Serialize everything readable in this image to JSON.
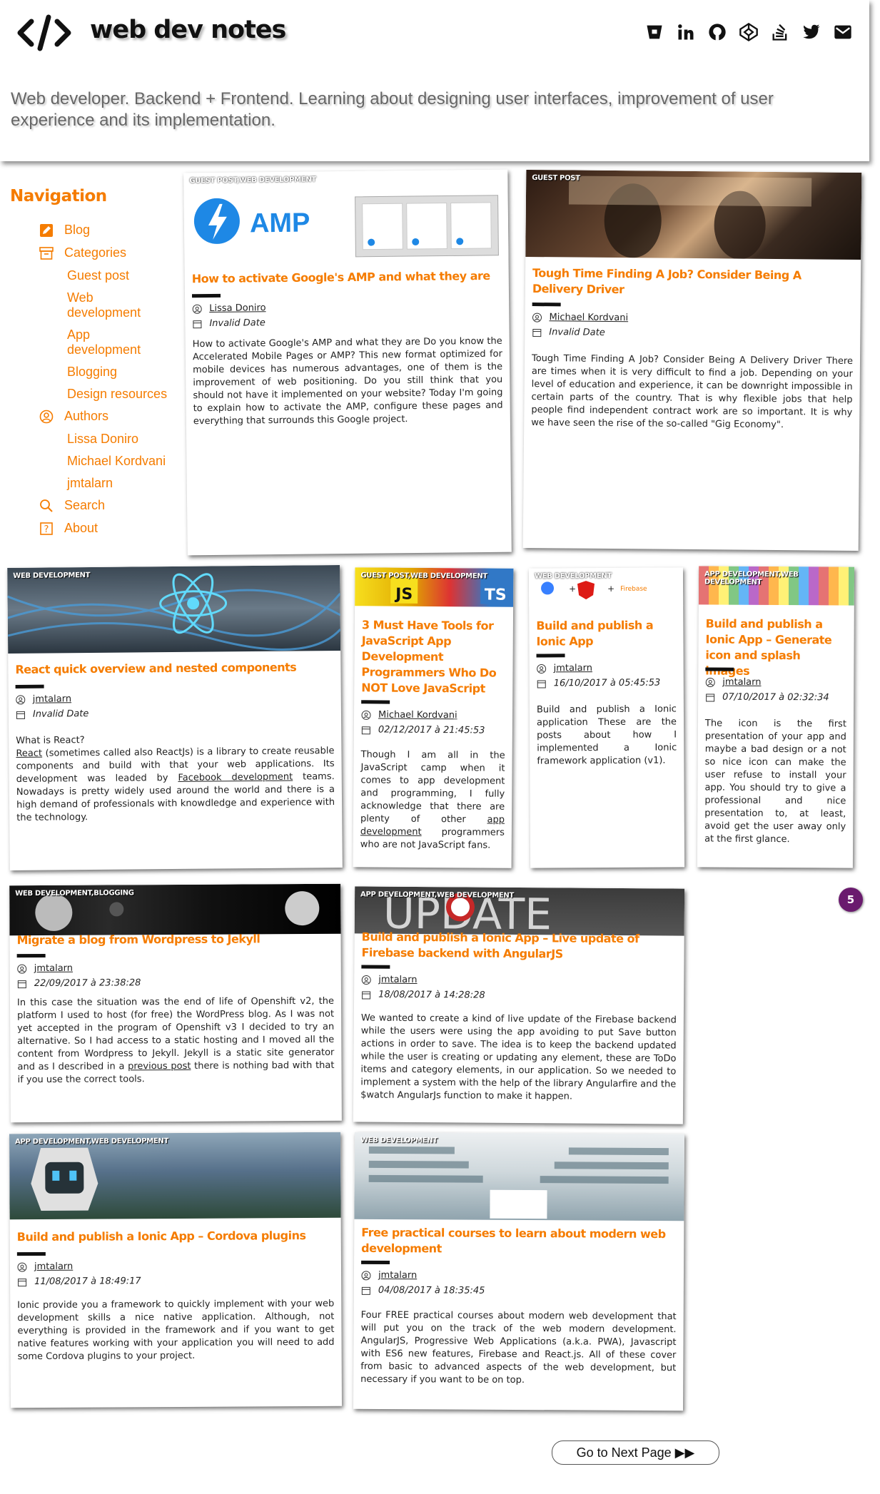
{
  "header": {
    "title": "web dev notes",
    "tagline": "Web developer. Backend + Frontend. Learning about designing user interfaces, improvement of user experience and its implementation.",
    "social_icons": [
      "bitbucket-icon",
      "linkedin-icon",
      "github-icon",
      "codepen-icon",
      "stackoverflow-icon",
      "twitter-icon",
      "email-icon"
    ]
  },
  "nav": {
    "title": "Navigation",
    "blog": "Blog",
    "categories": "Categories",
    "cat_items": [
      "Guest post",
      "Web development",
      "App development",
      "Blogging",
      "Design resources"
    ],
    "authors": "Authors",
    "author_items": [
      "Lissa Doniro",
      "Michael Kordvani",
      "jmtalarn"
    ],
    "search": "Search",
    "about": "About"
  },
  "posts": [
    {
      "category": "GUEST POST,WEB DEVELOPMENT",
      "title": "How to activate Google's AMP and what they are",
      "author": "Lissa Doniro",
      "date": "Invalid Date",
      "excerpt": "How to activate Google's AMP and what they are Do you know the Accelerated Mobile Pages or AMP? This new format optimized for mobile devices has numerous advantages, one of them is the improvement of web positioning. Do you still think that you should not have it implemented on your website? Today I'm going to explain how to activate the AMP, configure these pages and everything that surrounds this Google project."
    },
    {
      "category": "GUEST POST",
      "title": "Tough Time Finding A Job? Consider Being A Delivery Driver",
      "author": "Michael Kordvani",
      "date": "Invalid Date",
      "excerpt": "Tough Time Finding A Job? Consider Being A Delivery Driver There are times when it is very difficult to find a job. Depending on your level of education and experience, it can be downright impossible in certain parts of the country. That is why flexible jobs that help people find independent contract work are so important. It is why we have seen the rise of the so-called \"Gig Economy\"."
    },
    {
      "category": "WEB DEVELOPMENT",
      "title": "React quick overview and nested components",
      "author": "jmtalarn",
      "date": "Invalid Date",
      "excerpt_a": "What is React?",
      "excerpt_link1": "React",
      "excerpt_b": " (sometimes called also ReactJs) is a library to create reusable components and build with that your web applications. Its development was leaded by ",
      "excerpt_link2": "Facebook development",
      "excerpt_c": " teams. Nowadays is pretty widely used around the world and there is a high demand of professionals with knowdledge and experience with the technology."
    },
    {
      "category": "GUEST POST,WEB DEVELOPMENT",
      "title": "3 Must Have Tools for JavaScript App Development Programmers Who Do NOT Love JavaScript",
      "author": "Michael Kordvani",
      "date": "02/12/2017 à 21:45:53",
      "excerpt_a": "Though I am all in the JavaScript camp when it comes to app development and programming, I fully acknowledge that there are plenty of other ",
      "excerpt_link1": "app development",
      "excerpt_b": " programmers who are not JavaScript fans."
    },
    {
      "category": "WEB DEVELOPMENT",
      "title": "Build and publish a Ionic App",
      "author": "jmtalarn",
      "date": "16/10/2017 à 05:45:53",
      "excerpt": "Build and publish a Ionic application These are the posts about how I implemented a Ionic framework application (v1)."
    },
    {
      "category": "APP DEVELOPMENT,WEB DEVELOPMENT",
      "title": "Build and publish a Ionic App – Generate icon and splash images",
      "author": "jmtalarn",
      "date": "07/10/2017 à 02:32:34",
      "excerpt": "The icon is the first presentation of your app and maybe a bad design or a not so nice icon can make the user refuse to install your app. You should try to give a professional and nice presentation to, at least, avoid get the user away only at the first glance."
    },
    {
      "category": "WEB DEVELOPMENT,BLOGGING",
      "title": "Migrate a blog from Wordpress to Jekyll",
      "author": "jmtalarn",
      "date": "22/09/2017 à 23:38:28",
      "excerpt_a": "In this case the situation was the end of life of Openshift v2, the platform I used to host (for free) the WordPress blog. As I was not yet accepted in the program of Openshift v3 I decided to try an alternative. So I had access to a static hosting and I moved all the content from Wordpress to Jekyll. Jekyll is a static site generator and as I described in a ",
      "excerpt_link1": "previous post",
      "excerpt_b": " there is nothing bad with that if you use the correct tools."
    },
    {
      "category": "APP DEVELOPMENT,WEB DEVELOPMENT",
      "title": "Build and publish a Ionic App – Live update of Firebase backend with AngularJS",
      "author": "jmtalarn",
      "date": "18/08/2017 à 14:28:28",
      "excerpt": "We wanted to create a kind of live update of the Firebase backend while the users were using the app avoiding to put Save button actions in order to save. The idea is to keep the backend updated while the user is creating or updating any element, these are ToDo items and category elements, in our application. So we needed to implement a system with the help of the library Angularfire and the $watch AngularJs function to make it happen."
    },
    {
      "category": "APP DEVELOPMENT,WEB DEVELOPMENT",
      "title": "Build and publish a Ionic App – Cordova plugins",
      "author": "jmtalarn",
      "date": "11/08/2017 à 18:49:17",
      "excerpt": "Ionic provide you a framework to quickly implement with your web development skills a nice native application. Although, not everything is provided in the framework and if you want to get native features working with your application you will need to add some Cordova plugins to your project."
    },
    {
      "category": "WEB DEVELOPMENT",
      "title": "Free practical courses to learn about modern web development",
      "author": "jmtalarn",
      "date": "04/08/2017 à 18:35:45",
      "excerpt": "Four FREE practical courses about modern web development that will put you on the track of the web modern development. AngularJS, Progressive Web Applications (a.k.a. PWA), Javascript with ES6 new features, Firebase and React.js. All of these cover from basic to advanced aspects of the web development, but necessary if you want to be on top."
    }
  ],
  "image_text": {
    "amp": "AMP",
    "js": "JS",
    "ts": "TS",
    "firebase": "Firebase",
    "update": "UPDATE"
  },
  "pagination": {
    "badge": "5",
    "next": "Go to Next Page ▶▶"
  },
  "colors": {
    "accent": "#f57c00",
    "badge": "#6a1b6e"
  }
}
